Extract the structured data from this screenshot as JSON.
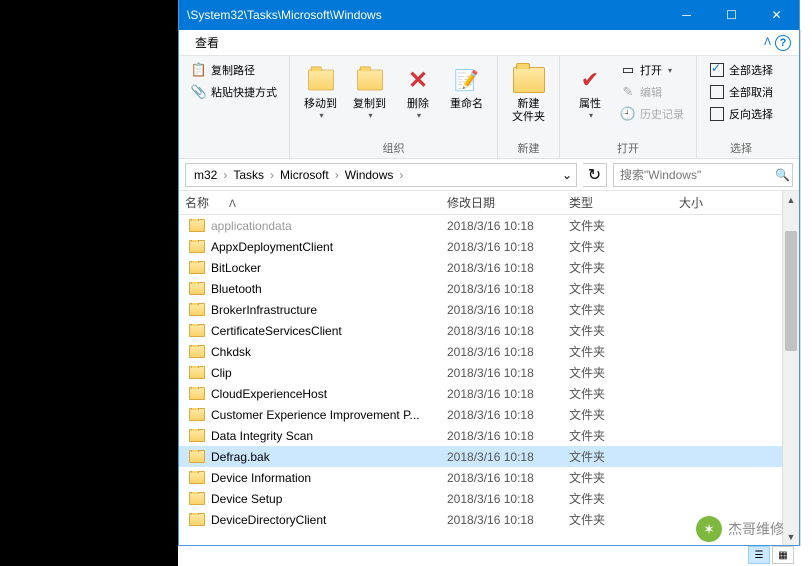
{
  "titlebar": {
    "path": "\\System32\\Tasks\\Microsoft\\Windows"
  },
  "menubar": {
    "view": "查看"
  },
  "ribbon": {
    "clipboard": {
      "copy_path": "复制路径",
      "paste_shortcut": "粘贴快捷方式"
    },
    "organize": {
      "move_to": "移动到",
      "copy_to": "复制到",
      "delete": "删除",
      "rename": "重命名",
      "group": "组织"
    },
    "new": {
      "new_folder": "新建\n文件夹",
      "group": "新建"
    },
    "open": {
      "properties": "属性",
      "open": "打开",
      "edit": "编辑",
      "history": "历史记录",
      "group": "打开"
    },
    "select": {
      "select_all": "全部选择",
      "select_none": "全部取消",
      "invert": "反向选择",
      "group": "选择"
    }
  },
  "breadcrumb": {
    "segs": [
      "m32",
      "Tasks",
      "Microsoft",
      "Windows"
    ]
  },
  "search": {
    "placeholder": "搜索\"Windows\""
  },
  "columns": {
    "name": "名称",
    "date": "修改日期",
    "type": "类型",
    "size": "大小"
  },
  "rows": [
    {
      "name": "applicationdata",
      "date": "2018/3/16 10:18",
      "type": "文件夹",
      "dim": true
    },
    {
      "name": "AppxDeploymentClient",
      "date": "2018/3/16 10:18",
      "type": "文件夹"
    },
    {
      "name": "BitLocker",
      "date": "2018/3/16 10:18",
      "type": "文件夹"
    },
    {
      "name": "Bluetooth",
      "date": "2018/3/16 10:18",
      "type": "文件夹"
    },
    {
      "name": "BrokerInfrastructure",
      "date": "2018/3/16 10:18",
      "type": "文件夹"
    },
    {
      "name": "CertificateServicesClient",
      "date": "2018/3/16 10:18",
      "type": "文件夹"
    },
    {
      "name": "Chkdsk",
      "date": "2018/3/16 10:18",
      "type": "文件夹"
    },
    {
      "name": "Clip",
      "date": "2018/3/16 10:18",
      "type": "文件夹"
    },
    {
      "name": "CloudExperienceHost",
      "date": "2018/3/16 10:18",
      "type": "文件夹"
    },
    {
      "name": "Customer Experience Improvement P...",
      "date": "2018/3/16 10:18",
      "type": "文件夹"
    },
    {
      "name": "Data Integrity Scan",
      "date": "2018/3/16 10:18",
      "type": "文件夹"
    },
    {
      "name": "Defrag.bak",
      "date": "2018/3/16 10:18",
      "type": "文件夹",
      "selected": true
    },
    {
      "name": "Device Information",
      "date": "2018/3/16 10:18",
      "type": "文件夹"
    },
    {
      "name": "Device Setup",
      "date": "2018/3/16 10:18",
      "type": "文件夹"
    },
    {
      "name": "DeviceDirectoryClient",
      "date": "2018/3/16 10:18",
      "type": "文件夹"
    }
  ],
  "watermark": {
    "text": "杰哥维修"
  }
}
